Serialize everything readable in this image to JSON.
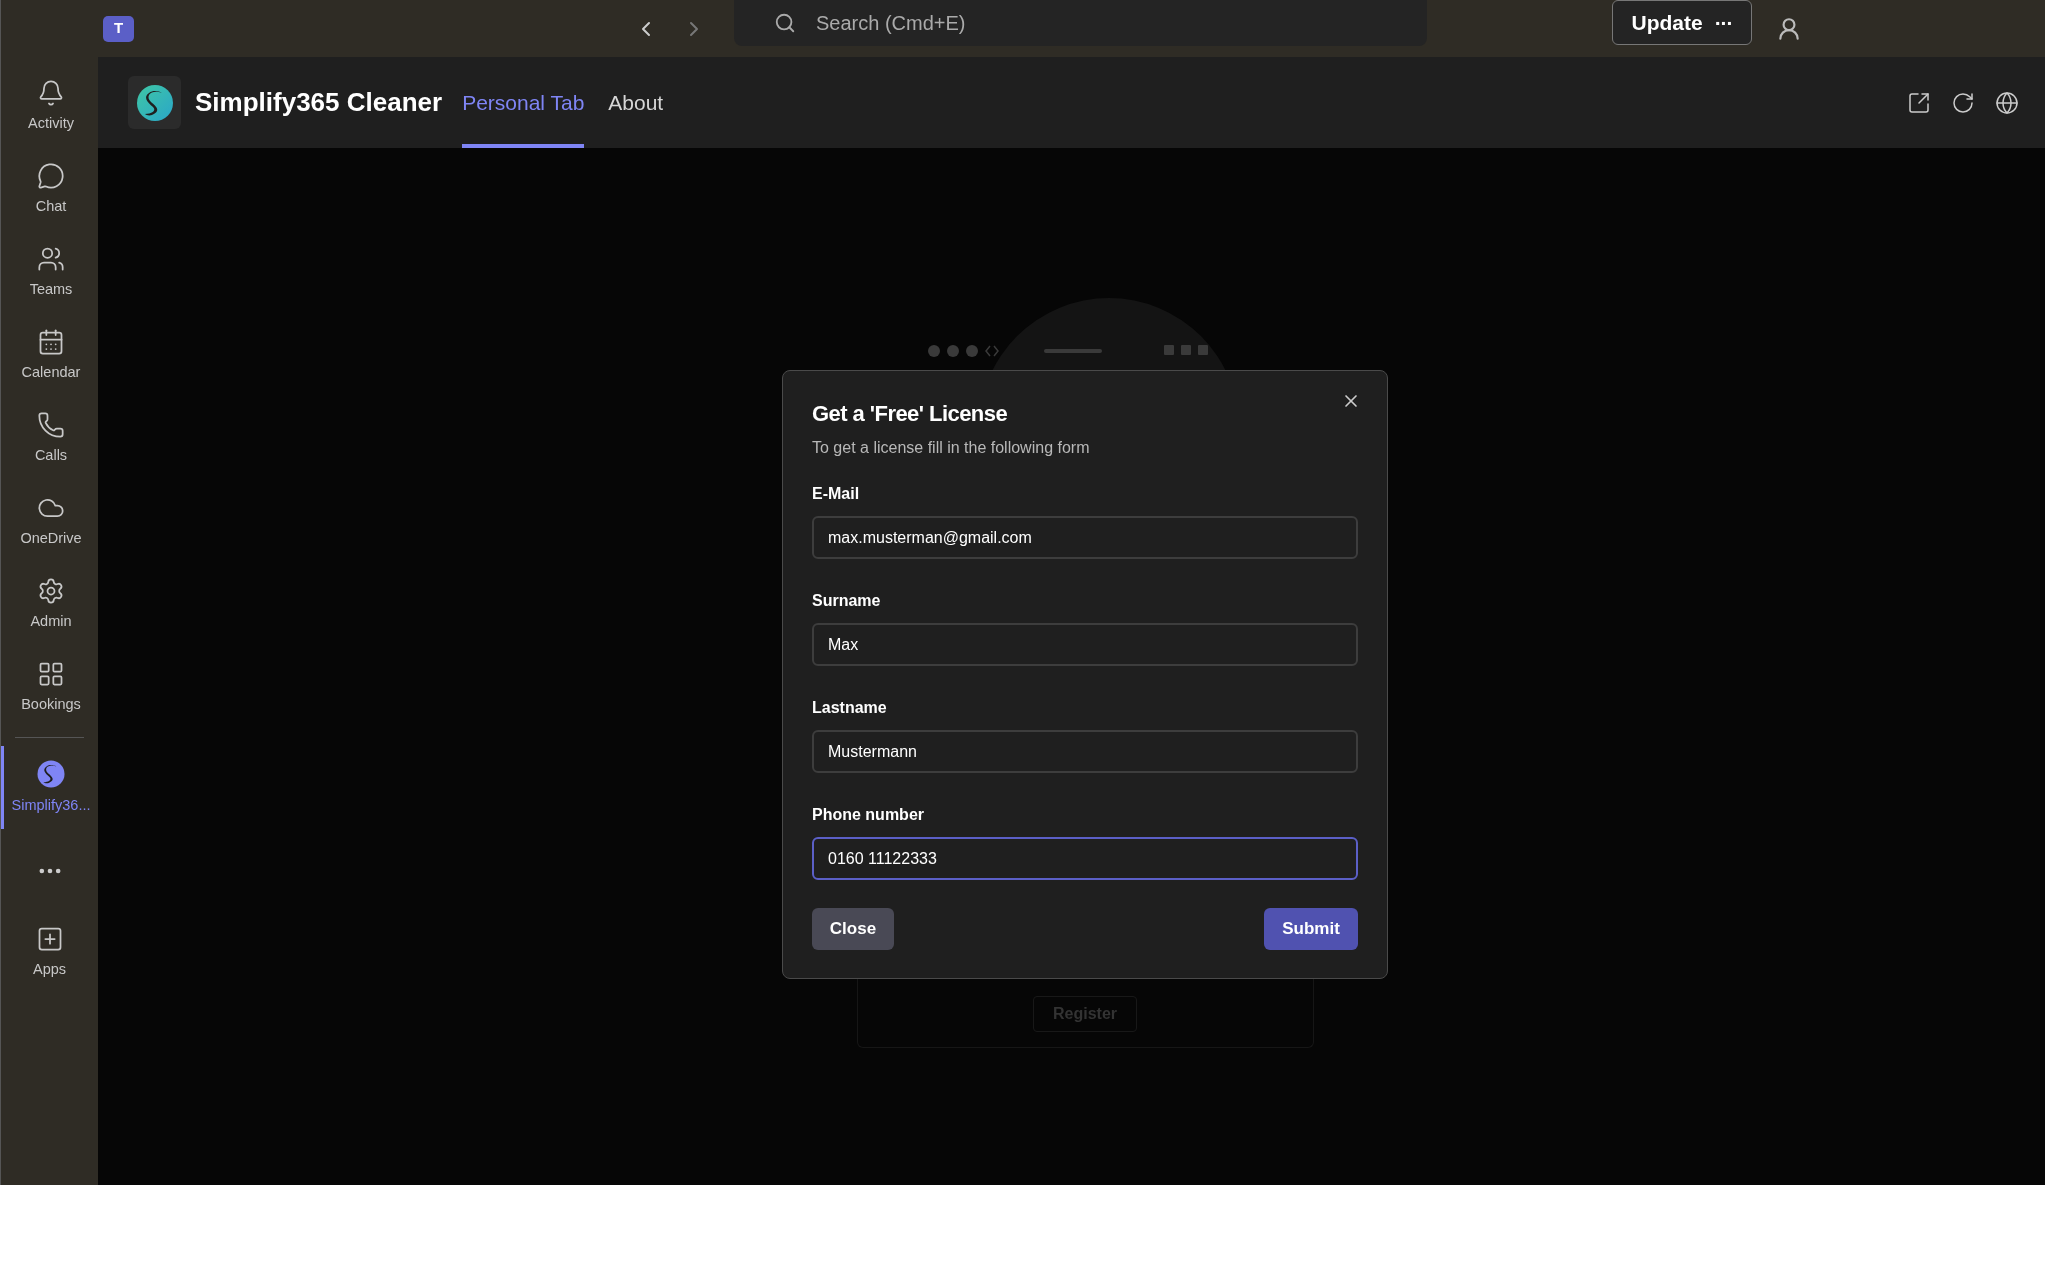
{
  "top_bar": {
    "logo_letter": "T",
    "search": {
      "placeholder": "Search (Cmd+E)"
    },
    "update_button": "Update",
    "more": "···"
  },
  "sidebar": {
    "items": [
      {
        "label": "Activity",
        "selected": false
      },
      {
        "label": "Chat",
        "selected": false
      },
      {
        "label": "Teams",
        "selected": false
      },
      {
        "label": "Calendar",
        "selected": false
      },
      {
        "label": "Calls",
        "selected": false
      },
      {
        "label": "OneDrive",
        "selected": false
      },
      {
        "label": "Admin",
        "selected": false
      },
      {
        "label": "Bookings",
        "selected": false
      },
      {
        "label": "Simplify36...",
        "selected": true
      }
    ],
    "apps": "Apps"
  },
  "app_header": {
    "title": "Simplify365 Cleaner",
    "tabs": [
      {
        "label": "Personal Tab",
        "selected": true
      },
      {
        "label": "About",
        "selected": false
      }
    ]
  },
  "background": {
    "register_button": "Register"
  },
  "dialog": {
    "title": "Get a 'Free' License",
    "subtitle": "To get a license fill in the following form",
    "fields": [
      {
        "label": "E-Mail",
        "value": "max.musterman@gmail.com",
        "focused": false
      },
      {
        "label": "Surname",
        "value": "Max",
        "focused": false
      },
      {
        "label": "Lastname",
        "value": "Mustermann",
        "focused": false
      },
      {
        "label": "Phone number",
        "value": "0160 11122333",
        "focused": true
      }
    ],
    "close_button": "Close",
    "submit_button": "Submit"
  }
}
